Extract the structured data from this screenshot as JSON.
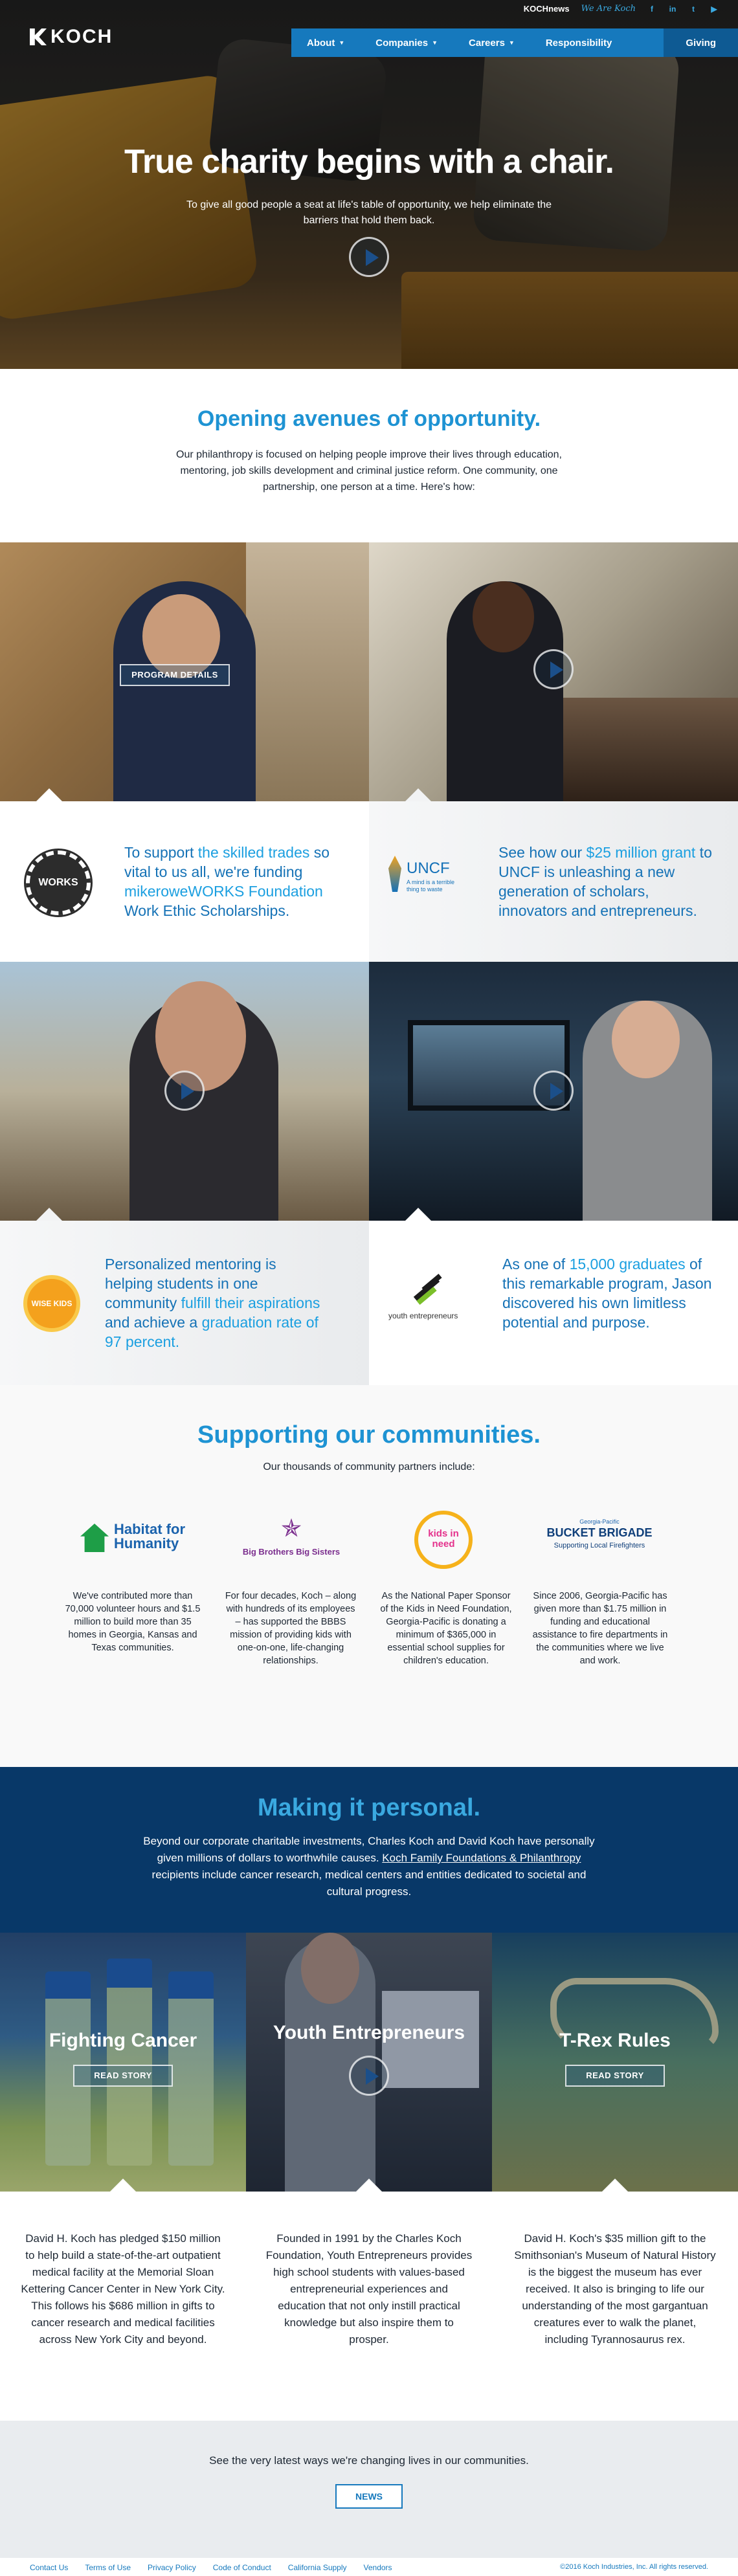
{
  "header": {
    "logo": "KOCH",
    "utility": {
      "koch_news": "KOCHnews",
      "we_are_koch": "We Are Koch"
    },
    "social_icons": [
      "facebook-icon",
      "linkedin-icon",
      "twitter-icon",
      "youtube-icon"
    ],
    "nav": [
      {
        "label": "About",
        "dropdown": true
      },
      {
        "label": "Companies",
        "dropdown": true
      },
      {
        "label": "Careers",
        "dropdown": true
      },
      {
        "label": "Responsibility",
        "dropdown": false
      },
      {
        "label": "Giving",
        "dropdown": false,
        "active": true
      }
    ]
  },
  "hero": {
    "title": "True charity begins with a chair.",
    "subtitle": "To give all good people a seat at life's table of opportunity, we help eliminate the barriers that hold them back."
  },
  "opening": {
    "title": "Opening avenues of opportunity.",
    "text": "Our philanthropy is focused on helping people improve their lives through education, mentoring, job skills development and criminal justice reform. One community, one partnership, one person at a time. Here's how:"
  },
  "programs": [
    {
      "button": "PROGRAM DETAILS",
      "logo": "WORKS",
      "text_plain1": "To support ",
      "text_hl1": "the skilled trades",
      "text_plain2": " so vital to us all, we're funding ",
      "text_hl2": "mikeroweWORKS Foundation",
      "text_plain3": " Work Ethic Scholarships."
    },
    {
      "logo": "UNCF",
      "logo_tag": "A mind is a terrible thing to waste",
      "text_plain1": "See how our ",
      "text_hl1": "$25 million grant",
      "text_plain2": " to UNCF is unleashing a new generation of scholars, innovators and entrepreneurs."
    },
    {
      "logo": "WISE KIDS",
      "text_plain1": "Personalized mentoring is helping students in one community ",
      "text_hl1": "fulfill their aspirations",
      "text_plain2": " and achieve a ",
      "text_hl2": "graduation rate of 97 percent."
    },
    {
      "logo": "youth entrepreneurs",
      "text_plain1": "As one of ",
      "text_hl1": "15,000 graduates",
      "text_plain2": " of this remarkable program, Jason discovered his own limitless potential and purpose."
    }
  ],
  "communities": {
    "title": "Supporting our communities.",
    "subtitle": "Our thousands of community partners include:",
    "partners": [
      {
        "logo": "Habitat for Humanity",
        "text": "We've contributed more than 70,000 volunteer hours and $1.5 million to build more than 35 homes in Georgia, Kansas and Texas communities."
      },
      {
        "logo": "Big Brothers Big Sisters",
        "text": "For four decades, Koch – along with hundreds of its employees – has supported the BBBS mission of providing kids with one-on-one, life-changing relationships."
      },
      {
        "logo": "kids in need",
        "text": "As the National Paper Sponsor of the Kids in Need Foundation, Georgia-Pacific is donating a minimum of $365,000 in essential school supplies for children's education."
      },
      {
        "logo": "BUCKET BRIGADE",
        "logo_top": "Georgia-Pacific",
        "logo_tag": "Supporting Local Firefighters",
        "text": "Since 2006, Georgia-Pacific has given more than $1.75 million in funding and educational assistance to fire departments in the communities where we live and work."
      }
    ]
  },
  "personal": {
    "title": "Making it personal.",
    "text_1": "Beyond our corporate charitable investments, Charles Koch and David Koch have personally given millions of dollars to worthwhile causes. ",
    "link": "Koch Family Foundations & Philanthropy",
    "text_2": " recipients include cancer research, medical centers and entities dedicated to societal and cultural progress."
  },
  "stories": [
    {
      "title": "Fighting Cancer",
      "button": "READ STORY",
      "text": "David H. Koch has pledged $150 million to help build a state-of-the-art outpatient medical facility at the Memorial Sloan Kettering Cancer Center in New York City. This follows his $686 million in gifts to cancer research and medical facilities across New York City and beyond."
    },
    {
      "title": "Youth Entrepreneurs",
      "text": "Founded in 1991 by the Charles Koch Foundation, Youth Entrepreneurs provides high school students with values-based entrepreneurial experiences and education that not only instill practical knowledge but also inspire them to prosper."
    },
    {
      "title": "T-Rex Rules",
      "button": "READ STORY",
      "text": "David H. Koch's $35 million gift to the Smithsonian's Museum of Natural History is the biggest the museum has ever received. It also is bringing to life our understanding of the most gargantuan creatures ever to walk the planet, including Tyrannosaurus rex."
    }
  ],
  "news": {
    "text": "See the very latest ways we're changing lives in our communities.",
    "button": "NEWS"
  },
  "footer": {
    "links": [
      "Contact Us",
      "Terms of Use",
      "Privacy Policy",
      "Code of Conduct",
      "California Supply",
      "Vendors"
    ],
    "copyright": "©2016 Koch Industries, Inc. All rights reserved."
  }
}
